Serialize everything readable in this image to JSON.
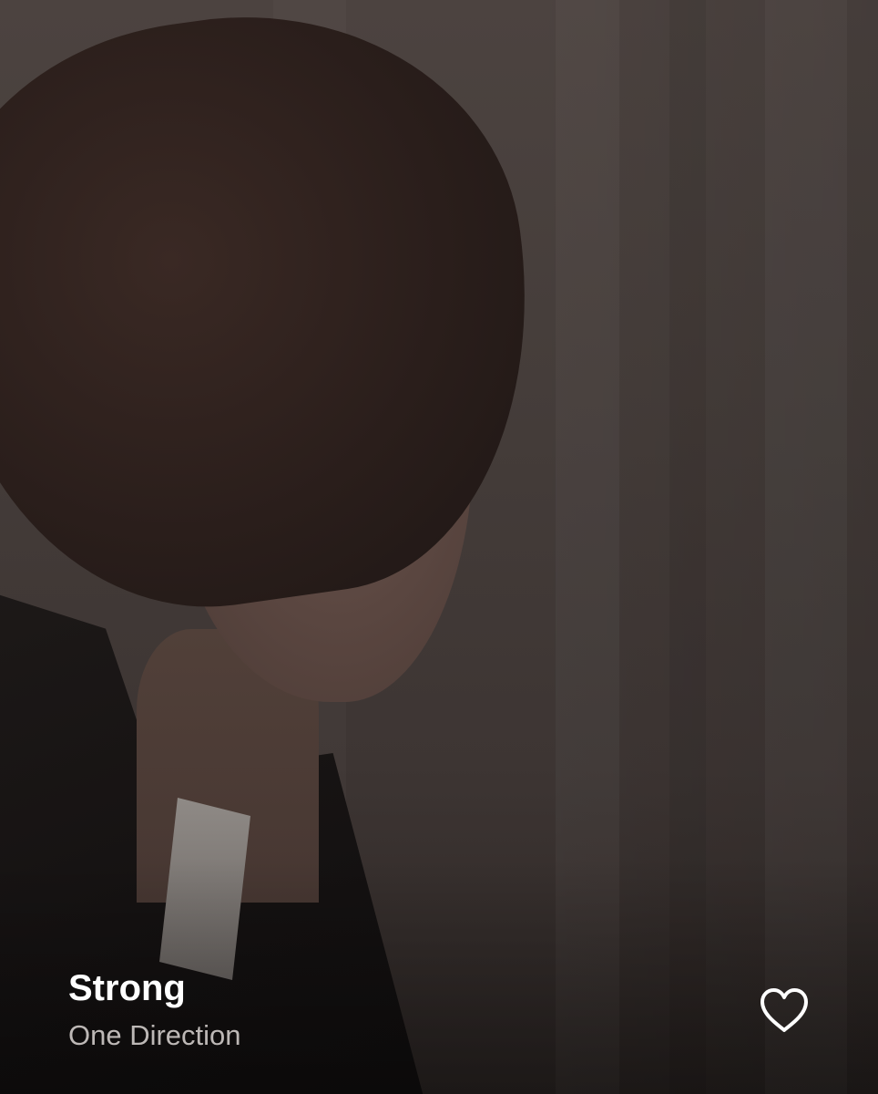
{
  "now_playing": {
    "title": "Strong",
    "artist": "One Direction",
    "like_icon": "heart-outline-icon"
  },
  "colors": {
    "title_text": "#ffffff",
    "artist_text": "#bdb8b6",
    "icon": "#ffffff"
  }
}
